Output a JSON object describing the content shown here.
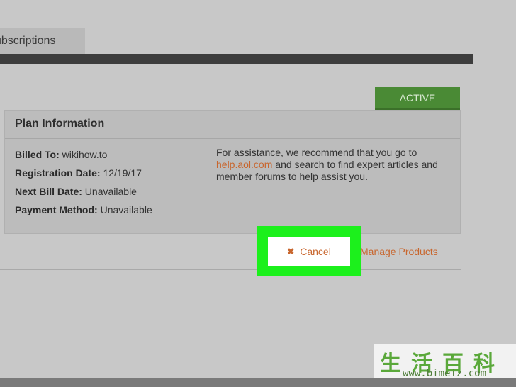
{
  "tab": {
    "label": "ubscriptions"
  },
  "status_badge": "ACTIVE",
  "plan": {
    "title": "Plan Information",
    "billed_to_label": "Billed To:",
    "billed_to_value": " wikihow.to",
    "registration_label": "Registration Date:",
    "registration_value": " 12/19/17",
    "next_bill_label": "Next Bill Date:",
    "next_bill_value": " Unavailable",
    "payment_label": "Payment Method:",
    "payment_value": " Unavailable",
    "help_prefix": "For assistance, we recommend that you go to",
    "help_link": "help.aol.com",
    "help_suffix": " and search to find expert articles and member forums to help assist you."
  },
  "actions": {
    "cancel_icon": "✖",
    "cancel_label": "Cancel",
    "manage_label": "Manage Products"
  },
  "watermark": {
    "chinese": "生活百科",
    "url": "www.bimeiz.com"
  },
  "colors": {
    "accent_link": "#c8662e",
    "active_badge": "#4a8a35",
    "highlight": "#1cf01c"
  }
}
